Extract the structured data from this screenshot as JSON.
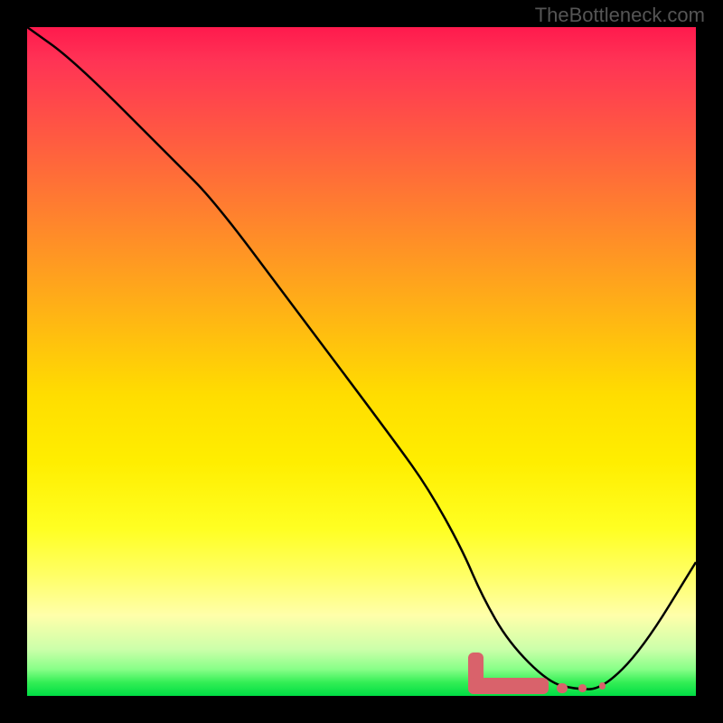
{
  "watermark": "TheBottleneck.com",
  "chart_data": {
    "type": "line",
    "title": "",
    "xlabel": "",
    "ylabel": "",
    "xlim": [
      0,
      100
    ],
    "ylim": [
      0,
      100
    ],
    "series": [
      {
        "name": "bottleneck-curve",
        "x": [
          0,
          7,
          22,
          28,
          40,
          55,
          60,
          65,
          68,
          72,
          78,
          82,
          86,
          92,
          100
        ],
        "y": [
          100,
          95,
          80,
          74,
          58,
          38,
          31,
          22,
          15,
          8,
          2,
          1,
          1,
          7,
          20
        ],
        "color": "#000000"
      }
    ],
    "markers": [
      {
        "name": "bottleneck-zone-main",
        "x_start": 66,
        "x_end": 78,
        "y": 1.5,
        "thickness": 2.5,
        "color": "#d9626b"
      },
      {
        "name": "bottleneck-dot-1",
        "x": 80,
        "y": 1.2,
        "size": 1.5,
        "color": "#d9626b"
      },
      {
        "name": "bottleneck-dot-2",
        "x": 83,
        "y": 1.2,
        "size": 1.2,
        "color": "#d9626b"
      },
      {
        "name": "bottleneck-dot-3",
        "x": 86,
        "y": 1.5,
        "size": 1.0,
        "color": "#d9626b"
      }
    ],
    "background_gradient": {
      "top": "#ff1a4d",
      "middle": "#ffee00",
      "bottom": "#00dd44"
    }
  }
}
